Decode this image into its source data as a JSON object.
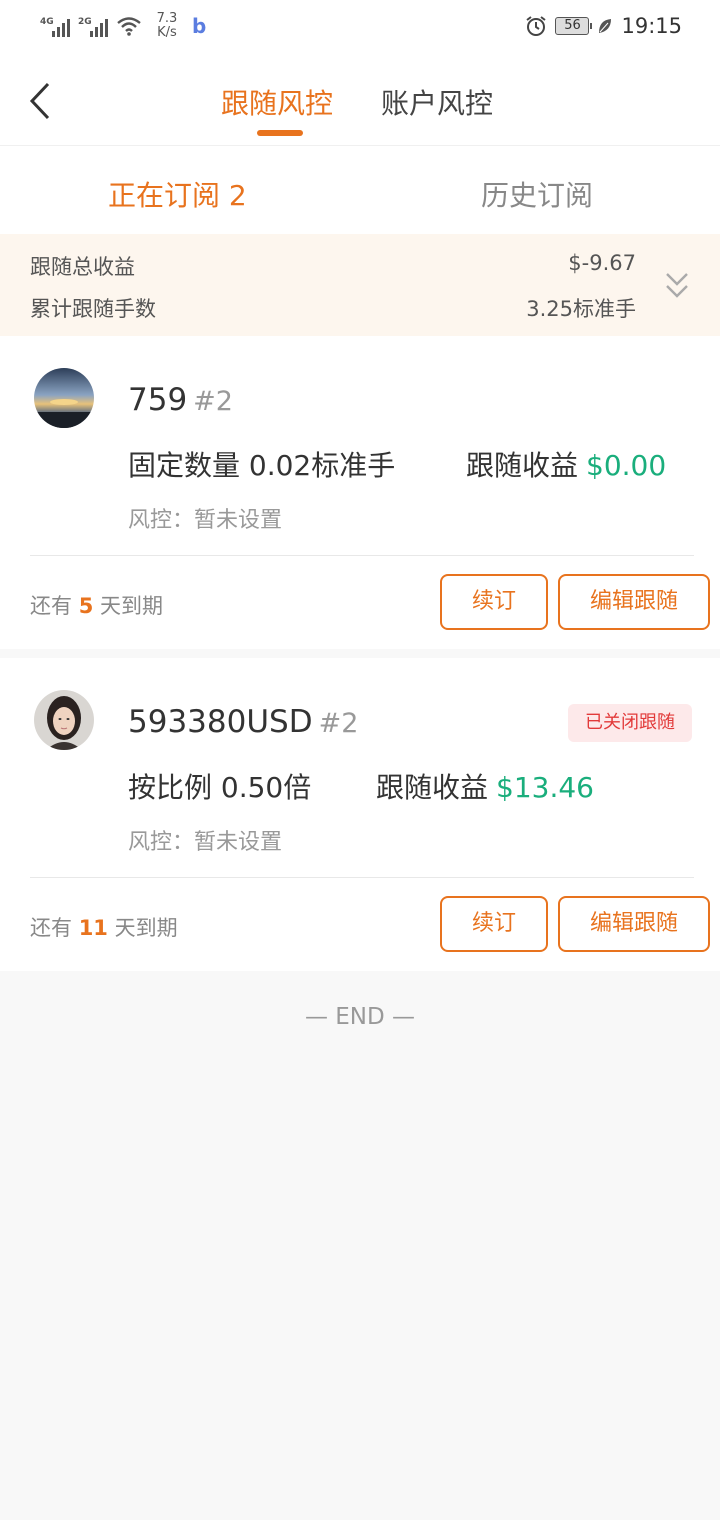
{
  "status_bar": {
    "signal1": "4G",
    "signal2": "2G",
    "net_speed_value": "7.3",
    "net_speed_unit": "K/s",
    "app_badge": "b",
    "battery": "56",
    "time": "19:15"
  },
  "header": {
    "tabs": [
      {
        "label": "跟随风控",
        "active": true
      },
      {
        "label": "账户风控",
        "active": false
      }
    ]
  },
  "subtabs": {
    "current": "正在订阅 2",
    "history": "历史订阅"
  },
  "summary": {
    "total_profit_label": "跟随总收益",
    "total_profit_value": "$-9.67",
    "total_lots_label": "累计跟随手数",
    "total_lots_value": "3.25标准手"
  },
  "subscriptions": [
    {
      "name": "759",
      "number": "#2",
      "mode": "固定数量 0.02标准手",
      "pnl_label": "跟随收益",
      "pnl_value": "$0.00",
      "risk": "风控：暂未设置",
      "expire_prefix": "还有",
      "expire_days": "5",
      "expire_suffix": "天到期",
      "badge": "",
      "renew_label": "续订",
      "edit_label": "编辑跟随"
    },
    {
      "name": "593380USD",
      "number": "#2",
      "mode": "按比例 0.50倍",
      "pnl_label": "跟随收益",
      "pnl_value": "$13.46",
      "risk": "风控：暂未设置",
      "expire_prefix": "还有",
      "expire_days": "11",
      "expire_suffix": "天到期",
      "badge": "已关闭跟随",
      "renew_label": "续订",
      "edit_label": "编辑跟随"
    }
  ],
  "footer": {
    "end_text": "— END —"
  },
  "colors": {
    "accent": "#e8731e",
    "profit": "#1aae7c",
    "badge_text": "#e23a3a",
    "badge_bg": "#fde9ea",
    "summary_bg": "#fdf6ee"
  },
  "icons": {
    "back": "chevron-left-icon",
    "expand": "double-chevron-down-icon",
    "alarm": "alarm-clock-icon",
    "wifi": "wifi-icon",
    "leaf": "leaf-icon"
  }
}
